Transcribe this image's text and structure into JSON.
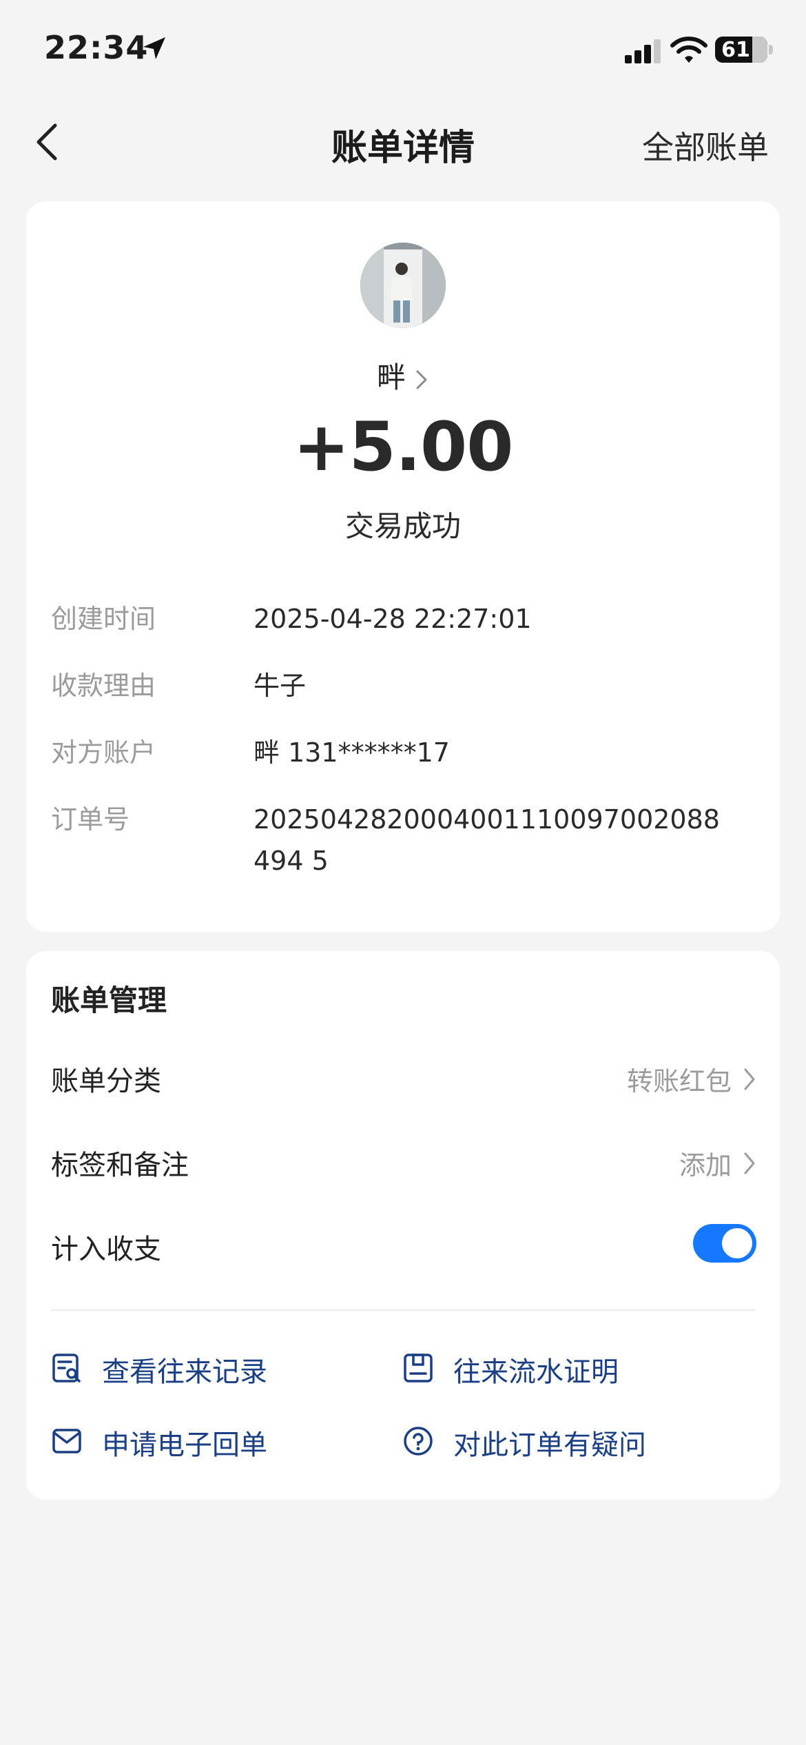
{
  "status_bar": {
    "time": "22:34",
    "battery": "61"
  },
  "nav": {
    "title": "账单详情",
    "right_link": "全部账单"
  },
  "transaction": {
    "payer_name": "畔",
    "amount": "+5.00",
    "status": "交易成功"
  },
  "details": [
    {
      "label": "创建时间",
      "value": "2025-04-28 22:27:01"
    },
    {
      "label": "收款理由",
      "value": "牛子"
    },
    {
      "label": "对方账户",
      "value": "畔 131******17"
    },
    {
      "label": "订单号",
      "value": "2025042820004001110097002088494 5"
    }
  ],
  "management": {
    "title": "账单管理",
    "category_label": "账单分类",
    "category_value": "转账红包",
    "tags_label": "标签和备注",
    "tags_value": "添加",
    "include_label": "计入收支",
    "include_enabled": true
  },
  "actions": {
    "records": "查看往来记录",
    "proof": "往来流水证明",
    "receipt": "申请电子回单",
    "question": "对此订单有疑问"
  },
  "colors": {
    "accent": "#1677ff",
    "link": "#1b3f84",
    "background": "#f4f4f4"
  }
}
